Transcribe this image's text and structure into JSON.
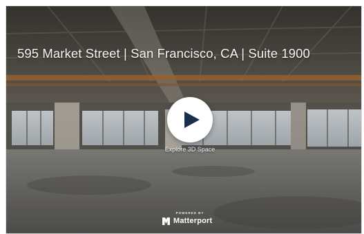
{
  "tour": {
    "title": "595 Market Street | San Francisco, CA | Suite 1900",
    "play_icon": "play-icon",
    "explore_label": "Explore 3D Space",
    "powered_by": "POWERED BY",
    "brand_name": "Matterport",
    "brand_icon": "matterport-logo-icon"
  },
  "colors": {
    "play_button": "#ffffff",
    "play_triangle": "#1a2f4d",
    "overlay_text": "#f4f4f4"
  }
}
